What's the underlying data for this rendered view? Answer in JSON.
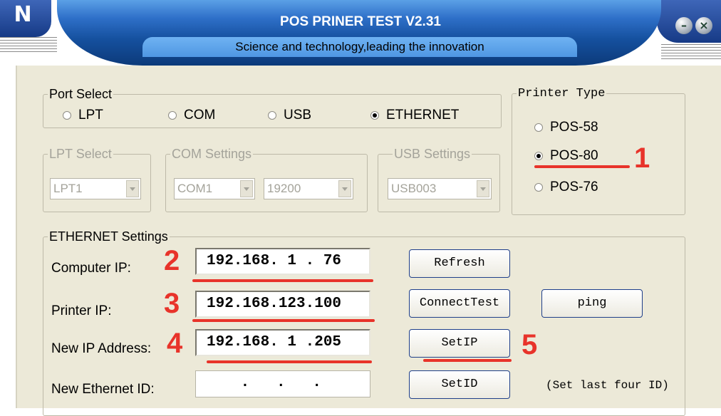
{
  "window": {
    "title": "POS PRINER TEST V2.31",
    "subtitle": "Science and technology,leading the innovation"
  },
  "port_select": {
    "legend": "Port Select",
    "options": [
      {
        "label": "LPT",
        "selected": false
      },
      {
        "label": "COM",
        "selected": false
      },
      {
        "label": "USB",
        "selected": false
      },
      {
        "label": "ETHERNET",
        "selected": true
      }
    ]
  },
  "printer_type": {
    "legend": "Printer Type",
    "options": [
      {
        "label": "POS-58",
        "selected": false
      },
      {
        "label": "POS-80",
        "selected": true
      },
      {
        "label": "POS-76",
        "selected": false
      }
    ]
  },
  "lpt_select": {
    "legend": "LPT Select",
    "value": "LPT1"
  },
  "com_settings": {
    "legend": "COM Settings",
    "port": "COM1",
    "baud": "19200"
  },
  "usb_settings": {
    "legend": "USB Settings",
    "value": "USB003"
  },
  "ethernet": {
    "legend": "ETHERNET Settings",
    "computer_ip_label": "Computer IP:",
    "computer_ip": "192.168. 1 . 76",
    "printer_ip_label": "Printer IP:",
    "printer_ip": "192.168.123.100",
    "new_ip_label": "New IP Address:",
    "new_ip": "192.168. 1 .205",
    "new_id_label": "New Ethernet ID:",
    "new_id": " .   .   . ",
    "refresh_label": "Refresh",
    "connect_test_label": "ConnectTest",
    "ping_label": "ping",
    "setip_label": "SetIP",
    "setid_label": "SetID",
    "setid_note": "(Set last four ID)"
  },
  "annotations": {
    "n1": "1",
    "n2": "2",
    "n3": "3",
    "n4": "4",
    "n5": "5",
    "color": "#e8332a"
  },
  "colors": {
    "window_bg": "#ece9d8",
    "title_blue": "#15509e",
    "accent_border": "#1f3f8a"
  }
}
